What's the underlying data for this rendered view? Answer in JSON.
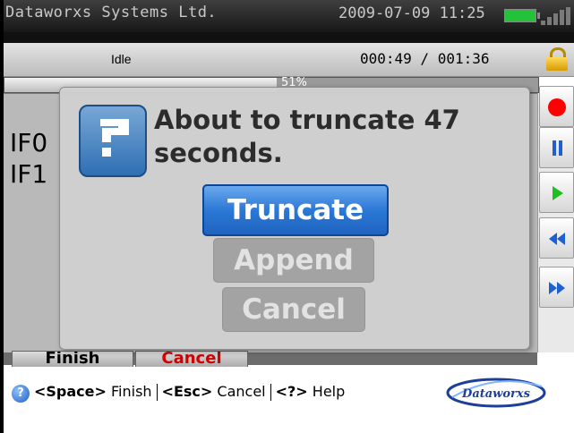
{
  "status_bar": {
    "company": "Dataworxs Systems Ltd.",
    "datetime": "2009-07-09 11:25",
    "battery_icon": "battery-icon",
    "signal_icon": "signal-icon"
  },
  "recorder": {
    "state": "Idle",
    "time_display": "000:49 / 001:36",
    "lock_icon": "lock-icon",
    "progress_percent": 51,
    "progress_label": "51%"
  },
  "channels": [
    {
      "label": "IF0"
    },
    {
      "label": "IF1"
    }
  ],
  "controls": [
    {
      "icon": "record-icon",
      "color": "#ff0000"
    },
    {
      "icon": "pause-icon",
      "color": "#1f5fd1"
    },
    {
      "icon": "play-icon",
      "color": "#1fbf1f"
    },
    {
      "icon": "rewind-icon",
      "color": "#1f5fd1"
    },
    {
      "icon": "fast-forward-icon",
      "color": "#1f5fd1"
    }
  ],
  "tabs": [
    {
      "label": "Finish"
    },
    {
      "label": "Cancel"
    }
  ],
  "dialog": {
    "icon": "question-icon",
    "message": "About to truncate 47 seconds.",
    "buttons": {
      "truncate": "Truncate",
      "append": "Append",
      "cancel": "Cancel"
    }
  },
  "help": {
    "icon": "help-icon",
    "space_key": "<Space>",
    "space_action": " Finish",
    "esc_key": "<Esc>",
    "esc_action": " Cancel",
    "help_key": "<?>",
    "help_action": " Help"
  },
  "logo": {
    "text": "Dataworxs"
  },
  "colors": {
    "accent": "#2b78d6",
    "battery": "#22c33a",
    "cancel_tab_text": "#d40000"
  }
}
